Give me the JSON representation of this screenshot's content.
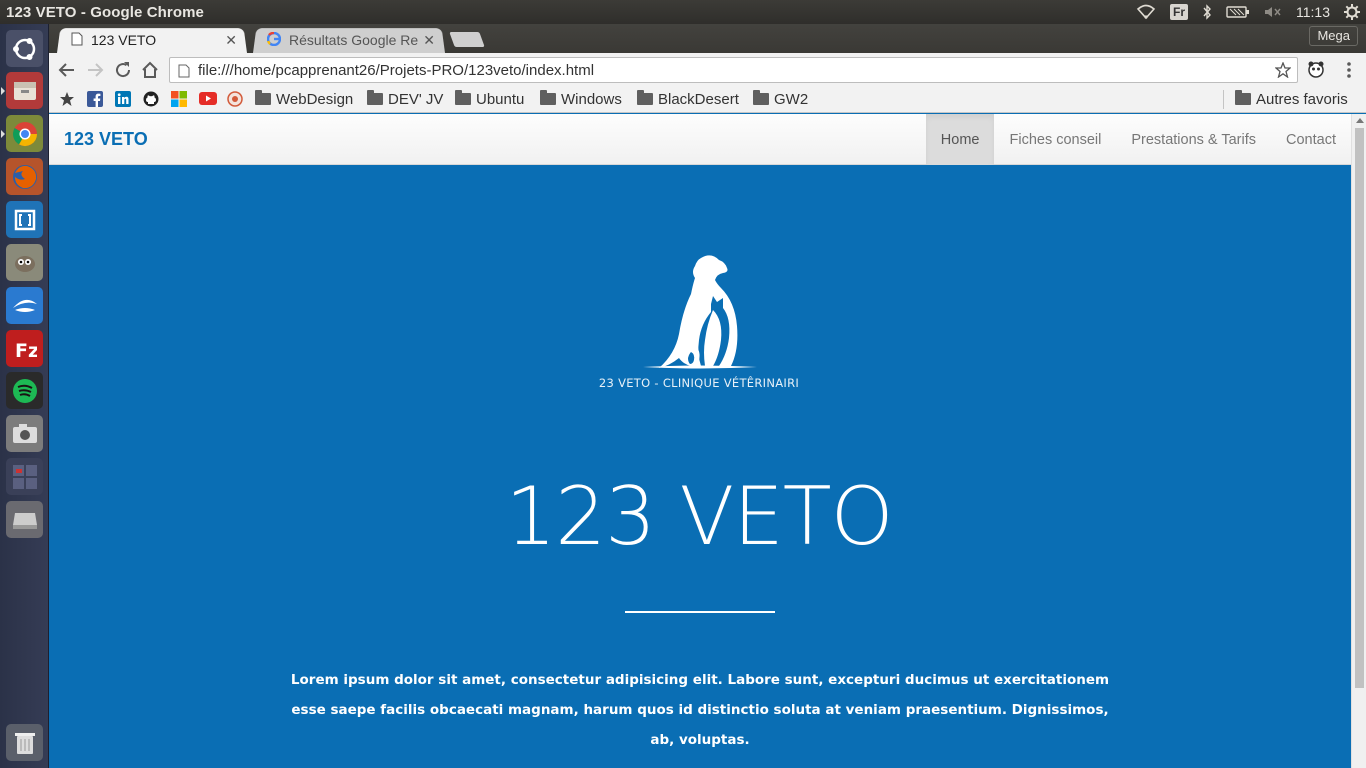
{
  "os": {
    "window_title": "123 VETO - Google Chrome",
    "keyboard_layout": "Fr",
    "clock": "11:13"
  },
  "launcher": {
    "apps": [
      "ubuntu-dash-icon",
      "files-icon",
      "chrome-icon",
      "firefox-icon",
      "brackets-icon",
      "gimp-icon",
      "thunderbird-icon",
      "filezilla-icon",
      "spotify-icon",
      "screenshot-icon",
      "workspaces-icon",
      "drive-icon",
      "trash-icon"
    ]
  },
  "browser": {
    "tabs": [
      {
        "label": "123 VETO",
        "active": true
      },
      {
        "label": "Résultats Google Re",
        "active": false
      }
    ],
    "extension_button": "Mega",
    "url": "file:///home/pcapprenant26/Projets-PRO/123veto/index.html",
    "bookmarks": [
      {
        "label": "WebDesign"
      },
      {
        "label": "DEV' JV"
      },
      {
        "label": "Ubuntu"
      },
      {
        "label": "Windows"
      },
      {
        "label": "BlackDesert"
      },
      {
        "label": "GW2"
      }
    ],
    "other_bookmarks": "Autres favoris"
  },
  "site": {
    "brand": "123 VETO",
    "menu": [
      {
        "label": "Home",
        "active": true
      },
      {
        "label": "Fiches conseil",
        "active": false
      },
      {
        "label": "Prestations & Tarifs",
        "active": false
      },
      {
        "label": "Contact",
        "active": false
      }
    ],
    "logo_caption": "23 VETO - CLINIQUE VÉTÊRINAIRI",
    "hero_title": "123 VETO",
    "hero_text": "Lorem ipsum dolor sit amet, consectetur adipisicing elit. Labore sunt, excepturi ducimus ut exercitationem esse saepe facilis obcaecati magnam, harum quos id distinctio soluta at veniam praesentium. Dignissimos, ab, voluptas."
  },
  "colors": {
    "hero_background": "#0a6eb4",
    "brand": "#0a6eb4"
  }
}
